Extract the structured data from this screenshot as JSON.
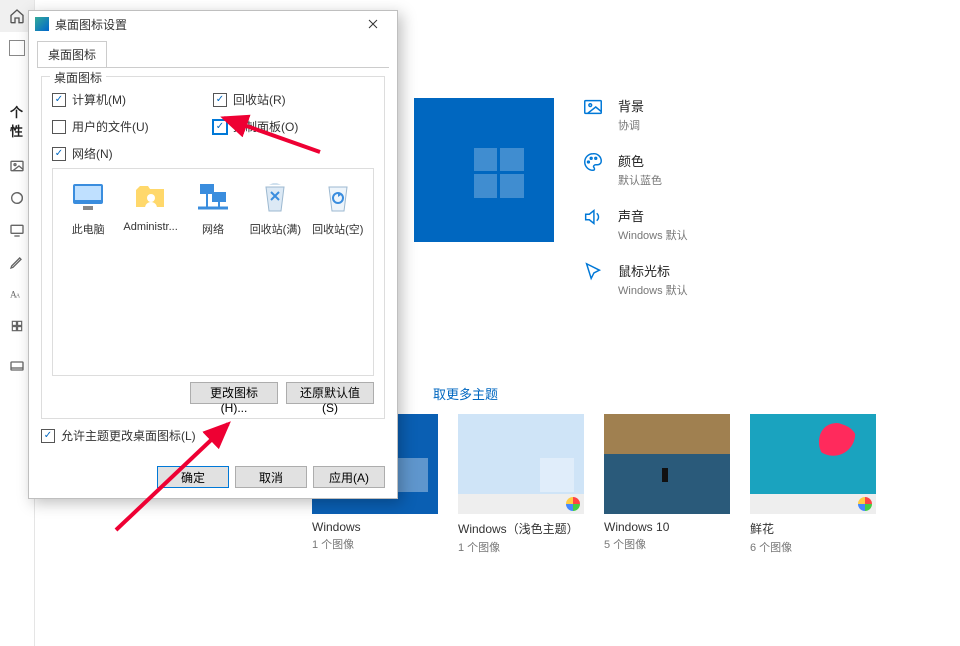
{
  "sidebar": {
    "label_fragment": "个性"
  },
  "settings": {
    "rows": [
      {
        "title": "背景",
        "sub": "协调"
      },
      {
        "title": "颜色",
        "sub": "默认蓝色"
      },
      {
        "title": "声音",
        "sub": "Windows 默认"
      },
      {
        "title": "鼠标光标",
        "sub": "Windows 默认"
      }
    ]
  },
  "more_link": "取更多主题",
  "themes": [
    {
      "name": "Windows",
      "count": "1 个图像",
      "cls": "win"
    },
    {
      "name": "Windows（浅色主题）",
      "count": "1 个图像",
      "cls": "light"
    },
    {
      "name": "Windows 10",
      "count": "5 个图像",
      "cls": "ten"
    },
    {
      "name": "鲜花",
      "count": "6 个图像",
      "cls": "flower"
    }
  ],
  "dialog": {
    "title": "桌面图标设置",
    "tab": "桌面图标",
    "group_title": "桌面图标",
    "checks": {
      "computer": "计算机(M)",
      "recycle": "回收站(R)",
      "userfiles": "用户的文件(U)",
      "cpanel": "控制面板(O)",
      "network": "网络(N)"
    },
    "icons": [
      {
        "label": "此电脑"
      },
      {
        "label": "Administr..."
      },
      {
        "label": "网络"
      },
      {
        "label": "回收站(满)"
      },
      {
        "label": "回收站(空)"
      }
    ],
    "change_icon": "更改图标(H)...",
    "restore": "还原默认值(S)",
    "allow_theme": "允许主题更改桌面图标(L)",
    "ok": "确定",
    "cancel": "取消",
    "apply": "应用(A)"
  }
}
